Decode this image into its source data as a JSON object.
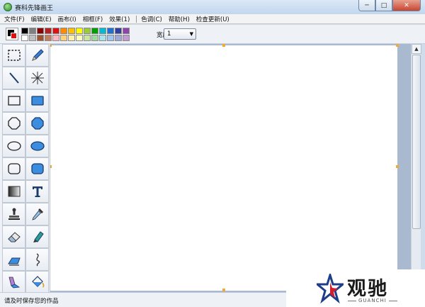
{
  "window": {
    "title": "赛科先锋画王",
    "controls": {
      "minimize": "─",
      "maximize": "□",
      "close": "✕"
    }
  },
  "menu": {
    "items": [
      {
        "label": "文件(F)"
      },
      {
        "label": "编辑(E)"
      },
      {
        "label": "画布(I)"
      },
      {
        "label": "相框(F)"
      },
      {
        "label": "效果(1)"
      },
      {
        "label": "色调(C)"
      },
      {
        "label": "帮助(H)"
      },
      {
        "label": "检查更新(U)"
      }
    ]
  },
  "toolbar": {
    "current_colors": {
      "foreground": "#000000",
      "background": "#e01010"
    },
    "palette": [
      "#000000",
      "#808080",
      "#8b0000",
      "#b22222",
      "#e01010",
      "#ff8c00",
      "#ffc000",
      "#ffff00",
      "#9acd32",
      "#00a000",
      "#00bcd4",
      "#1e6fd0",
      "#303f9f",
      "#8e44ad",
      "#ffffff",
      "#c0c0c0",
      "#a0522d",
      "#c08060",
      "#ffb6c1",
      "#ffd27f",
      "#fff2a8",
      "#ffffc0",
      "#c8e6a0",
      "#a0d8a0",
      "#a8e4f0",
      "#9ec5f0",
      "#9fa8da",
      "#c39bd3"
    ],
    "width_label": "宽度:",
    "width_value": "1",
    "dropdown_arrow": "▼"
  },
  "tools": [
    {
      "name": "select-rect-tool",
      "icon": "dashed-rect-icon"
    },
    {
      "name": "pencil-tool",
      "icon": "pencil-icon"
    },
    {
      "name": "line-tool",
      "icon": "line-icon"
    },
    {
      "name": "spray-tool",
      "icon": "starburst-icon"
    },
    {
      "name": "rect-outline-tool",
      "icon": "rect-outline-icon"
    },
    {
      "name": "rect-filled-tool",
      "icon": "rect-filled-icon"
    },
    {
      "name": "octagon-outline-tool",
      "icon": "octagon-outline-icon"
    },
    {
      "name": "octagon-filled-tool",
      "icon": "octagon-filled-icon"
    },
    {
      "name": "ellipse-outline-tool",
      "icon": "ellipse-outline-icon"
    },
    {
      "name": "ellipse-filled-tool",
      "icon": "ellipse-filled-icon"
    },
    {
      "name": "rounded-rect-outline-tool",
      "icon": "rounded-rect-outline-icon"
    },
    {
      "name": "rounded-rect-filled-tool",
      "icon": "rounded-rect-filled-icon"
    },
    {
      "name": "gradient-tool",
      "icon": "gradient-icon"
    },
    {
      "name": "text-tool",
      "icon": "text-t-icon"
    },
    {
      "name": "stamp-tool",
      "icon": "stamp-icon"
    },
    {
      "name": "eyedropper-tool",
      "icon": "eyedropper-icon"
    },
    {
      "name": "eraser-tool",
      "icon": "eraser-icon"
    },
    {
      "name": "marker-tool",
      "icon": "marker-icon"
    },
    {
      "name": "brush-tool",
      "icon": "brush-icon"
    },
    {
      "name": "curve-tool",
      "icon": "curve-icon"
    },
    {
      "name": "fill-brush-tool",
      "icon": "fill-brush-icon"
    },
    {
      "name": "paint-bucket-tool",
      "icon": "paint-bucket-icon"
    }
  ],
  "scrollbar": {
    "up_arrow": "▲"
  },
  "status": {
    "text": "请及时保存您的作品"
  },
  "watermark": {
    "name": "观驰",
    "sub": "GUANCHI"
  }
}
